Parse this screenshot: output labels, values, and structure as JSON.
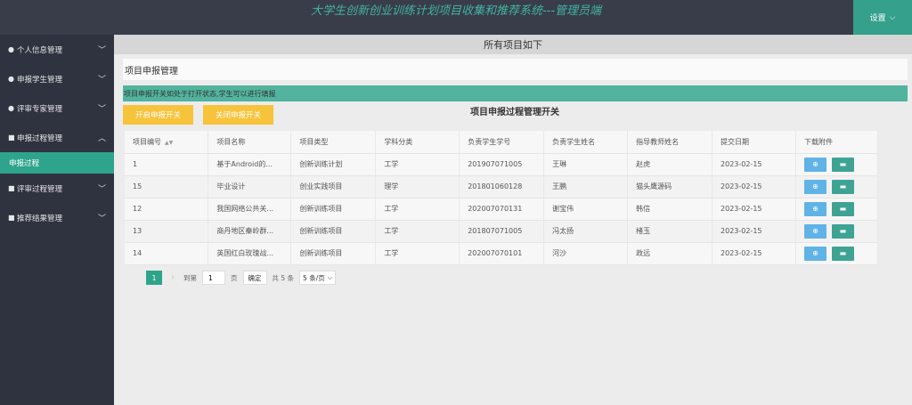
{
  "header": {
    "title": "大学生创新创业训练计划项目收集和推荐系统---管理员端",
    "settings_label": "设置",
    "settings_icon": "chevron-down-icon"
  },
  "sidebar": {
    "items": [
      {
        "label": "个人信息管理",
        "icon": "user-icon",
        "chevron": "﹀"
      },
      {
        "label": "申报学生管理",
        "icon": "users-icon",
        "chevron": "﹀"
      },
      {
        "label": "评审专家管理",
        "icon": "users-icon",
        "chevron": "﹀"
      },
      {
        "label": "申报过程管理",
        "icon": "card-icon",
        "chevron": "︿"
      },
      {
        "label": "评审过程管理",
        "icon": "card-icon",
        "chevron": "﹀"
      },
      {
        "label": "推荐结果管理",
        "icon": "card-icon",
        "chevron": "﹀"
      }
    ],
    "active_sub_item": "申报过程"
  },
  "main": {
    "header": "所有项目如下",
    "panel_title": "项目申报管理",
    "notice": "项目申报开关如处于打开状态,学生可以进行填报",
    "open_button": "开启申报开关",
    "close_button": "关闭申报开关",
    "table_title": "项目申报过程管理开关"
  },
  "table": {
    "columns": [
      "项目编号",
      "项目名称",
      "项目类型",
      "学科分类",
      "负责学生学号",
      "负责学生姓名",
      "指导教师姓名",
      "提交日期",
      "下载附件"
    ],
    "rows": [
      [
        "1",
        "基于Android的...",
        "创新训练计划",
        "工学",
        "201907071005",
        "王琳",
        "赵虎",
        "2023-02-15"
      ],
      [
        "15",
        "毕业设计",
        "创业实践项目",
        "理学",
        "201801060128",
        "王鹏",
        "猫头鹰源码",
        "2023-02-15"
      ],
      [
        "12",
        "我国网络公共关...",
        "创新训练项目",
        "工学",
        "202007070131",
        "谢宝伟",
        "韩信",
        "2023-02-15"
      ],
      [
        "13",
        "商丹地区秦岭群...",
        "创新训练项目",
        "工学",
        "201807071005",
        "冯太扬",
        "楮玉",
        "2023-02-15"
      ],
      [
        "14",
        "英国红白玫瑰战...",
        "创新训练项目",
        "工学",
        "202007070101",
        "河沙",
        "政远",
        "2023-02-15"
      ]
    ]
  },
  "pagination": {
    "current": "1",
    "goto_label": "到第",
    "page_value": "1",
    "page_unit": "页",
    "confirm": "确定",
    "total": "共 5 条",
    "page_size": "5 条/页"
  },
  "colors": {
    "accent": "#2ea48c",
    "topbar": "#393d49",
    "sidebar": "#2f3340",
    "warn_button": "#f7c33b"
  }
}
